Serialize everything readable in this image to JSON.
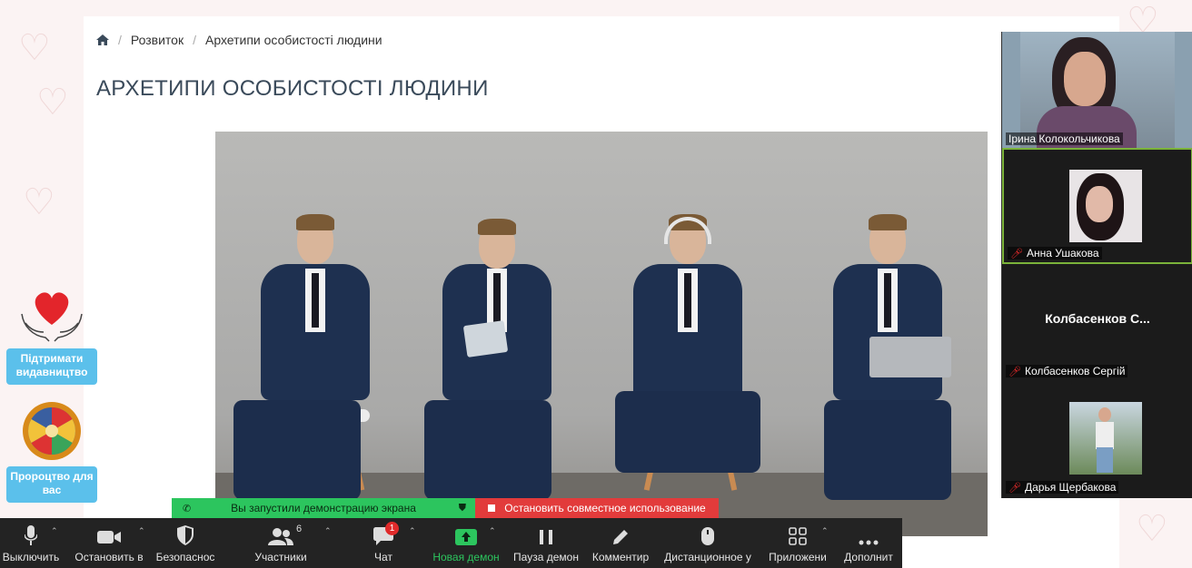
{
  "breadcrumb": {
    "home_icon": "home-icon",
    "items": [
      "Розвиток",
      "Архетипи особистості людини"
    ]
  },
  "page": {
    "title": "АРХЕТИПИ ОСОБИСТОСТІ ЛЮДИНИ"
  },
  "sidebar": {
    "support_label": "Підтримати видавництво",
    "prophecy_label": "Пророцтво для вас"
  },
  "video": {
    "participants": [
      {
        "name": "Ірина Колокольчикова",
        "muted": false
      },
      {
        "name": "Анна Ушакова",
        "muted": true
      },
      {
        "name": "Колбасенков Сергій",
        "display": "Колбасенков  С...",
        "muted": true
      },
      {
        "name": "Дарья Щербакова",
        "muted": true
      }
    ]
  },
  "share": {
    "started_label": "Вы запустили демонстрацию экрана",
    "stop_label": "Остановить совместное использование"
  },
  "toolbar": {
    "mute": "Выключить",
    "video": "Остановить в",
    "security": "Безопаснос",
    "participants": "Участники",
    "participants_count": "6",
    "chat": "Чат",
    "chat_badge": "1",
    "share": "Новая демон",
    "pause": "Пауза демон",
    "annotate": "Комментир",
    "remote": "Дистанционное у",
    "apps": "Приложени",
    "more": "Дополнит"
  },
  "colors": {
    "accent_green": "#2cc55e",
    "stop_red": "#e23b3b",
    "sidebar_button": "#5bc0eb",
    "toolbar_bg": "#232323"
  }
}
